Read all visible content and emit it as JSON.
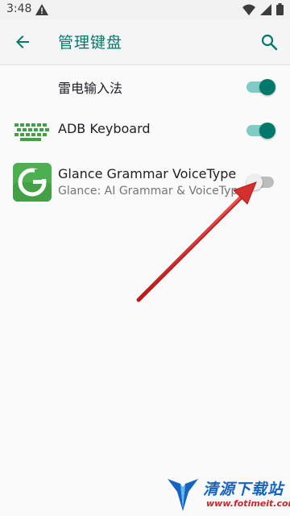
{
  "status_bar": {
    "time": "3:48",
    "icons": [
      "alert-icon",
      "wifi-icon",
      "signal-icon",
      "battery-icon"
    ]
  },
  "header": {
    "title": "管理键盘",
    "back_icon": "arrow-left-icon",
    "search_icon": "search-icon"
  },
  "keyboards": [
    {
      "title": "雷电输入法",
      "subtitle": "",
      "enabled": true
    },
    {
      "title": "ADB Keyboard",
      "subtitle": "",
      "enabled": true,
      "icon": "keyboard-icon"
    },
    {
      "title": "Glance Grammar VoiceType",
      "subtitle": "Glance: AI Grammar & VoiceType",
      "enabled": false,
      "icon": "glance-logo-icon"
    }
  ],
  "overlay": {
    "arrow_color": "#e53935"
  },
  "watermark": {
    "text": "清源下载站",
    "url": "www.fotimeit.com"
  },
  "colors": {
    "accent": "#00796b",
    "switch_on_track": "#80cbc4",
    "switch_off_track": "#bdbdbd"
  }
}
